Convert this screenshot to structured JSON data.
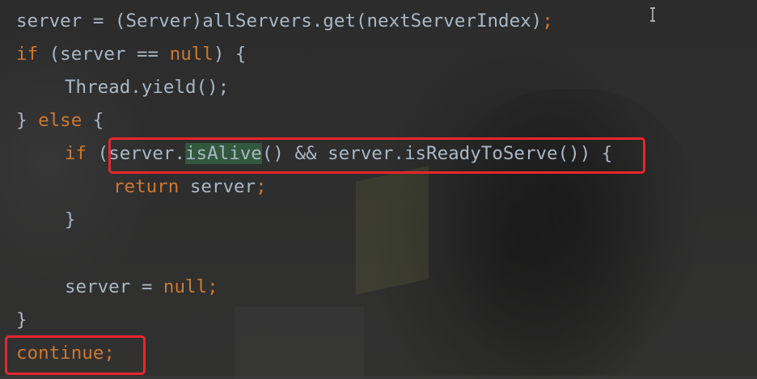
{
  "editor": {
    "lines": [
      {
        "id": "line1",
        "parts": [
          "server = (Server)",
          "allServers.get(nextServerIndex)",
          ";"
        ]
      },
      {
        "id": "line2",
        "parts": [
          "if",
          " (server == ",
          "null",
          ") {"
        ]
      },
      {
        "id": "line3",
        "parts": [
          "Thread.",
          "yield",
          "();"
        ]
      },
      {
        "id": "line4",
        "parts": [
          "} ",
          "else",
          " {"
        ]
      },
      {
        "id": "line5",
        "parts": [
          "if",
          " (",
          "server.",
          "isAlive",
          "() && server.",
          "isReadyToServe",
          "()) {"
        ]
      },
      {
        "id": "line6",
        "parts": [
          "return",
          " server",
          ";"
        ]
      },
      {
        "id": "line7",
        "parts": [
          "}"
        ]
      },
      {
        "id": "line8",
        "parts": [
          "server = ",
          "null",
          ";"
        ]
      },
      {
        "id": "line9",
        "parts": [
          "}"
        ]
      },
      {
        "id": "line10",
        "parts": [
          "continue",
          ";"
        ]
      }
    ]
  },
  "annotations": [
    {
      "name": "condition-highlight-box",
      "color": "#e8262c"
    },
    {
      "name": "continue-highlight-box",
      "color": "#e8262c"
    }
  ],
  "colors": {
    "background": "#2b2b2b",
    "keyword": "#cc7832",
    "identifier": "#a9b7c6",
    "method_call": "#ffc66d",
    "usage_highlight": "#32593d",
    "annotation": "#e8262c"
  },
  "cursor": {
    "icon": "i-beam-cursor-icon"
  }
}
